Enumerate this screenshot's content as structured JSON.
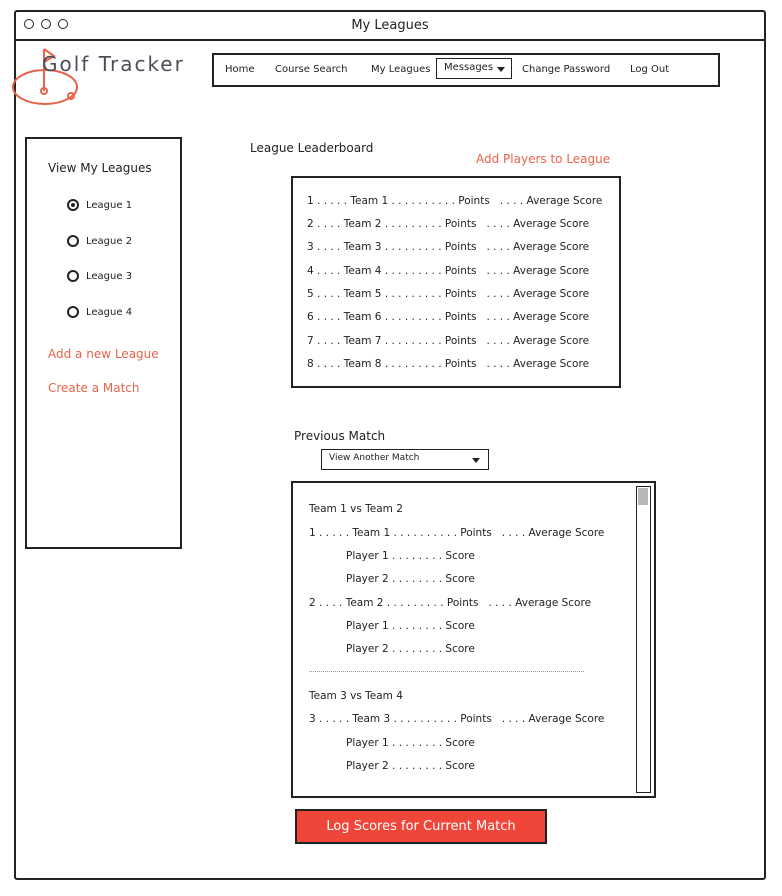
{
  "window": {
    "title": "My Leagues"
  },
  "app": {
    "name": "Golf Tracker",
    "accent_color": "#e8634a",
    "button_color": "#f0463a"
  },
  "nav": {
    "items": [
      "Home",
      "Course Search",
      "My Leagues",
      "Messages",
      "Change Password",
      "Log Out"
    ]
  },
  "sidebar": {
    "title": "View My Leagues",
    "leagues": [
      {
        "label": "League 1",
        "selected": true
      },
      {
        "label": "League 2",
        "selected": false
      },
      {
        "label": "League 3",
        "selected": false
      },
      {
        "label": "League 4",
        "selected": false
      }
    ],
    "links": [
      "Add a new League",
      "Create a Match"
    ]
  },
  "leaderboard": {
    "title": "League Leaderboard",
    "add_players_link": "Add Players to League",
    "rows": [
      "1 . . . . . Team 1 . . . . . . . . . . Points   . . . . Average Score",
      "2 . . . . Team 2 . . . . . . . . . Points   . . . . Average Score",
      "3 . . . . Team 3 . . . . . . . . . Points   . . . . Average Score",
      "4 . . . . Team 4 . . . . . . . . . Points   . . . . Average Score",
      "5 . . . . Team 5 . . . . . . . . . Points   . . . . Average Score",
      "6 . . . . Team 6 . . . . . . . . . Points   . . . . Average Score",
      "7 . . . . Team 7 . . . . . . . . . Points   . . . . Average Score",
      "8 . . . . Team 8 . . . . . . . . . Points   . . . . Average Score"
    ]
  },
  "previous_match": {
    "title": "Previous Match",
    "dropdown_label": "View Another Match",
    "lines": [
      "Team 1 vs Team 2",
      "1 . . . . . Team 1 . . . . . . . . . . Points   . . . . Average Score",
      "Player 1 . . . . . . . . Score",
      "Player 2 . . . . . . . . Score",
      "2 . . . . Team 2 . . . . . . . . . Points   . . . . Average Score",
      "Player 1 . . . . . . . . Score",
      "Player 2 . . . . . . . . Score",
      "Team 3 vs Team 4",
      "3 . . . . . Team 3 . . . . . . . . . . Points   . . . . Average Score",
      "Player 1 . . . . . . . . Score",
      "Player 2 . . . . . . . . Score"
    ]
  },
  "log_scores_button": "Log Scores for Current Match"
}
